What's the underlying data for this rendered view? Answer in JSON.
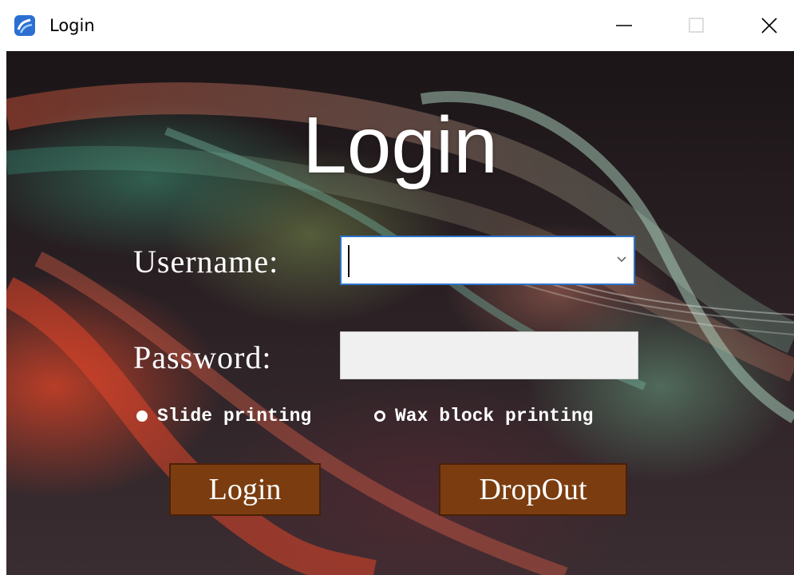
{
  "window": {
    "title": "Login",
    "controls": [
      "minimize",
      "maximize",
      "close"
    ]
  },
  "form": {
    "heading": "Login",
    "username_label": "Username:",
    "username_value": "",
    "password_label": "Password:",
    "password_value": ""
  },
  "print_mode": {
    "options": [
      {
        "label": "Slide printing",
        "selected": true
      },
      {
        "label": "Wax block printing",
        "selected": false
      }
    ]
  },
  "buttons": {
    "login_label": "Login",
    "dropout_label": "DropOut"
  },
  "colors": {
    "button_bg": "#7b3d10",
    "combo_border": "#2d73c9",
    "app_icon": "#2c6fd1"
  }
}
